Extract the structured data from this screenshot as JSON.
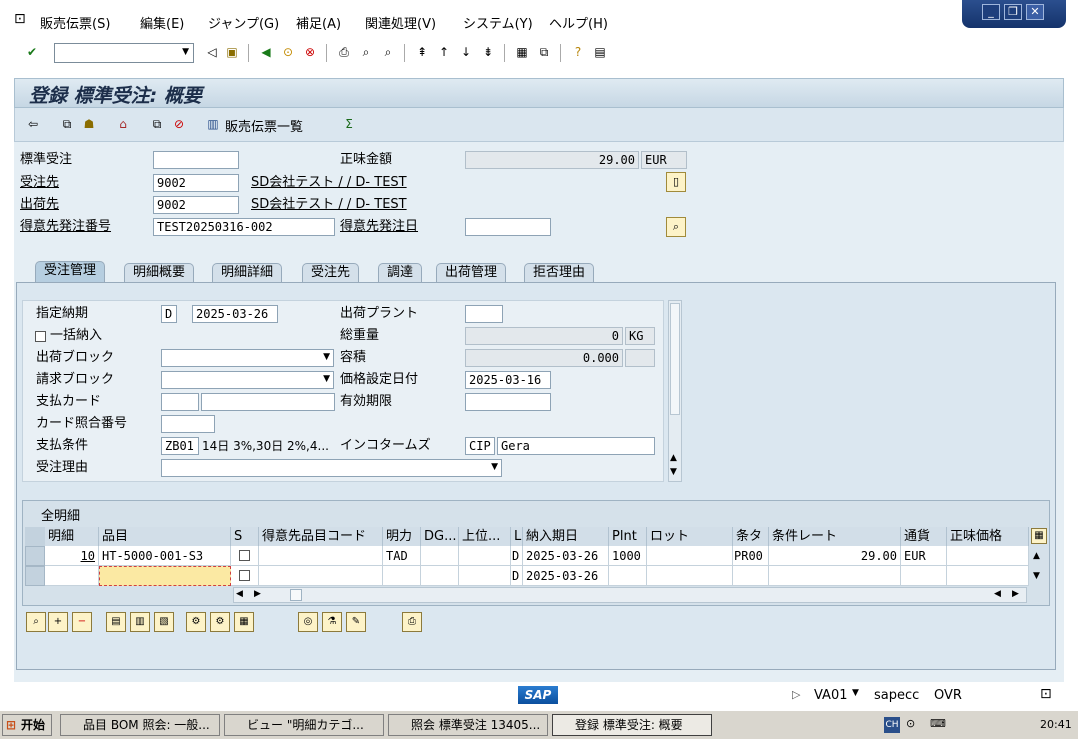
{
  "menu": [
    "販売伝票(S)",
    "編集(E)",
    "ジャンプ(G)",
    "補足(A)",
    "関連処理(V)",
    "システム(Y)",
    "ヘルプ(H)"
  ],
  "title": "登録 標準受注: 概要",
  "app_toolbar": {
    "doc_list_label": "販売伝票一覧"
  },
  "header": {
    "order_type_label": "標準受注",
    "order_type_value": "",
    "net_value_label": "正味金額",
    "net_value": "29.00",
    "currency": "EUR",
    "sold_to_label": "受注先",
    "sold_to": "9002",
    "sold_to_name": "SD会社テスト / / D- TEST",
    "ship_to_label": "出荷先",
    "ship_to": "9002",
    "ship_to_name": "SD会社テスト / / D- TEST",
    "po_number_label": "得意先発注番号",
    "po_number": "TEST20250316-002",
    "po_date_label": "得意先発注日",
    "po_date": ""
  },
  "tabs": [
    "受注管理",
    "明細概要",
    "明細詳細",
    "受注先",
    "調達",
    "出荷管理",
    "拒否理由"
  ],
  "sales_tab": {
    "req_deliv_date_label": "指定納期",
    "req_deliv_date_type": "D",
    "req_deliv_date": "2025-03-26",
    "shipping_plant_label": "出荷プラント",
    "shipping_plant": "",
    "complete_dlv_label": "一括納入",
    "total_weight_label": "総重量",
    "total_weight": "0",
    "weight_unit": "KG",
    "delivery_block_label": "出荷ブロック",
    "delivery_block": "",
    "volume_label": "容積",
    "volume": "0.000",
    "volume_unit": "",
    "billing_block_label": "請求ブロック",
    "billing_block": "",
    "pricing_date_label": "価格設定日付",
    "pricing_date": "2025-03-16",
    "payment_card_label": "支払カード",
    "payment_card": "",
    "valid_to_label": "有効期限",
    "valid_to": "",
    "card_verif_label": "カード照合番号",
    "card_verif": "",
    "payment_terms_label": "支払条件",
    "payment_terms": "ZB01",
    "payment_terms_text": "14日 3%,30日 2%,4...",
    "incoterms_label": "インコタームズ",
    "incoterms": "CIP",
    "incoterms_place": "Gera",
    "order_reason_label": "受注理由",
    "order_reason": ""
  },
  "items_table": {
    "title": "全明細",
    "columns": [
      "明細",
      "品目",
      "S",
      "得意先品目コード",
      "明力",
      "DG...",
      "上位...",
      "L",
      "納入期日",
      "Plnt",
      "ロット",
      "条タ",
      "条件レート",
      "通貨",
      "正味価格"
    ],
    "rows": [
      {
        "item": "10",
        "material": "HT-5000-001-S3",
        "s": "",
        "cust_mat": "",
        "cat": "TAD",
        "dg": "",
        "higher": "",
        "l": "D",
        "date": "2025-03-26",
        "plant": "1000",
        "batch": "",
        "cond_type": "PR00",
        "rate": "29.00",
        "curr": "EUR",
        "net": ""
      },
      {
        "item": "",
        "material": "",
        "s": "",
        "cust_mat": "",
        "cat": "",
        "dg": "",
        "higher": "",
        "l": "D",
        "date": "2025-03-26",
        "plant": "",
        "batch": "",
        "cond_type": "",
        "rate": "",
        "curr": "",
        "net": ""
      }
    ]
  },
  "status": {
    "tcode": "VA01",
    "server": "sapecc",
    "mode": "OVR"
  },
  "taskbar": {
    "start": "开始",
    "tasks": [
      "品目 BOM 照会: 一般...",
      "ビュー \"明細カテゴ...",
      "照会 標準受注 13405...",
      "登録 標準受注: 概要"
    ],
    "tray_time": "20:41"
  },
  "colors": {
    "titlebar": "#c6d7e4",
    "panel": "#dbe7f0",
    "accent": "#14336b"
  }
}
